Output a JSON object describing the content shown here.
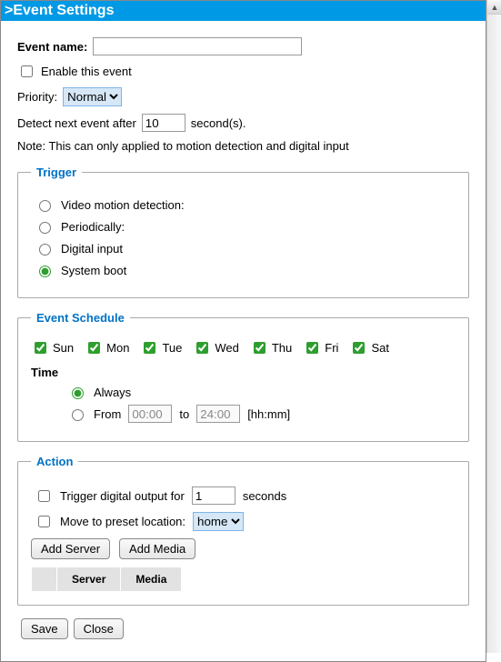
{
  "titlebar": ">Event Settings",
  "labels": {
    "eventName": "Event name:",
    "enableEvent": "Enable this event",
    "priority": "Priority:",
    "detectPre": "Detect next event after",
    "detectPost": "second(s).",
    "note": "Note: This can only applied to motion detection and digital input"
  },
  "fields": {
    "eventName": "",
    "prioritySelected": "Normal",
    "detectSeconds": "10"
  },
  "trigger": {
    "legend": "Trigger",
    "options": {
      "motion": "Video motion detection:",
      "periodic": "Periodically:",
      "digital": "Digital input",
      "boot": "System boot"
    },
    "selected": "boot"
  },
  "schedule": {
    "legend": "Event Schedule",
    "days": [
      "Sun",
      "Mon",
      "Tue",
      "Wed",
      "Thu",
      "Fri",
      "Sat"
    ],
    "timeLabel": "Time",
    "always": "Always",
    "fromLabel": "From",
    "toLabel": "to",
    "from": "00:00",
    "to": "24:00",
    "fmt": "[hh:mm]",
    "timeMode": "always"
  },
  "action": {
    "legend": "Action",
    "triggerOutPre": "Trigger digital output for",
    "triggerOutVal": "1",
    "triggerOutPost": "seconds",
    "movePreset": "Move to preset location:",
    "presetSelected": "home",
    "addServer": "Add Server",
    "addMedia": "Add Media",
    "colServer": "Server",
    "colMedia": "Media"
  },
  "buttons": {
    "save": "Save",
    "close": "Close"
  }
}
